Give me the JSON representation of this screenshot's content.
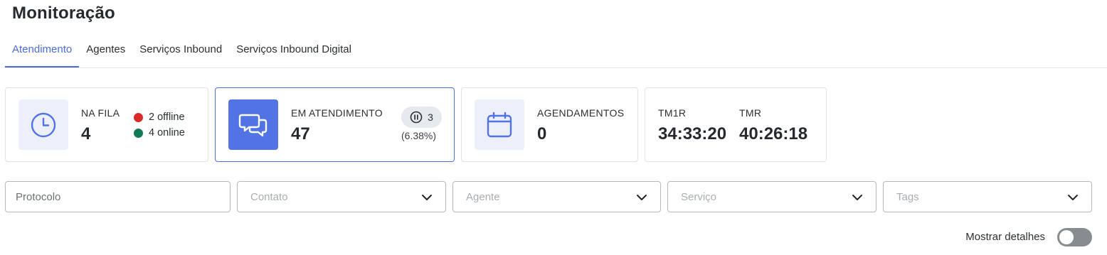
{
  "page": {
    "title": "Monitoração"
  },
  "tabs": [
    {
      "label": "Atendimento",
      "active": true
    },
    {
      "label": "Agentes",
      "active": false
    },
    {
      "label": "Serviços Inbound",
      "active": false
    },
    {
      "label": "Serviços Inbound Digital",
      "active": false
    }
  ],
  "cards": {
    "queue": {
      "label": "NA FILA",
      "value": "4",
      "offline": "2 offline",
      "online": "4 online",
      "icon": "clock-icon"
    },
    "in_service": {
      "label": "EM ATENDIMENTO",
      "value": "47",
      "paused_count": "3",
      "paused_pct": "(6.38%)",
      "icon": "chat-bubbles-icon"
    },
    "scheduled": {
      "label": "AGENDAMENTOS",
      "value": "0",
      "icon": "calendar-icon"
    },
    "times": {
      "tm1r_label": "TM1R",
      "tm1r_value": "34:33:20",
      "tmr_label": "TMR",
      "tmr_value": "40:26:18"
    }
  },
  "filters": {
    "protocolo_placeholder": "Protocolo",
    "contato_placeholder": "Contato",
    "agente_placeholder": "Agente",
    "servico_placeholder": "Serviço",
    "tags_placeholder": "Tags"
  },
  "details": {
    "label": "Mostrar detalhes",
    "enabled": false
  },
  "colors": {
    "accent": "#4d6bd8",
    "offline": "#d92b2b",
    "online": "#127a56",
    "icon_bg": "#edf0fb"
  }
}
